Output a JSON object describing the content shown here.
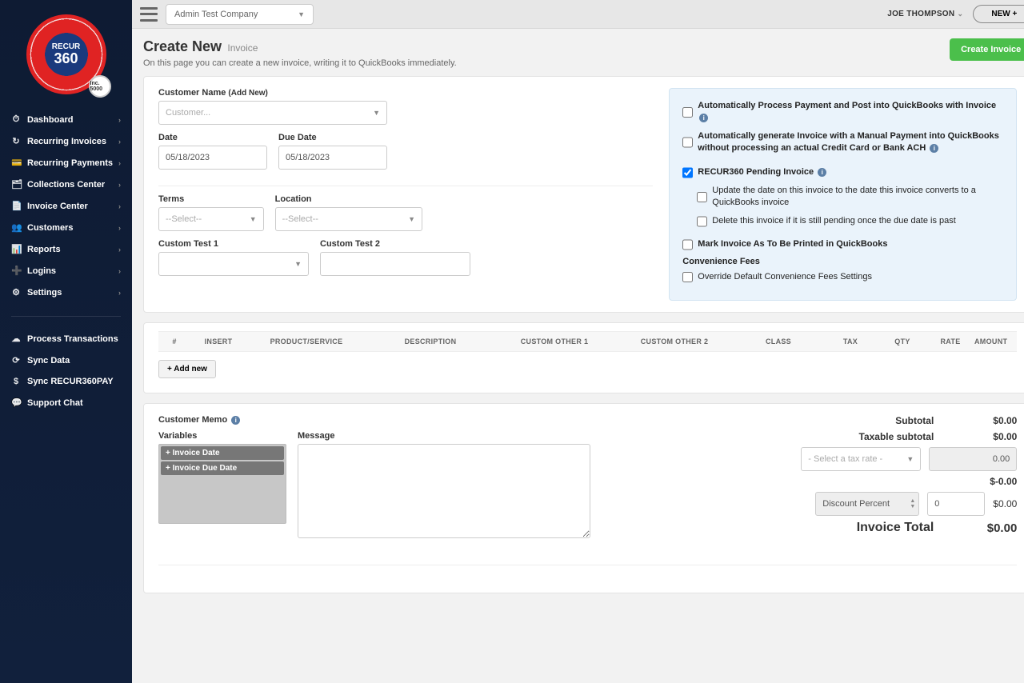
{
  "logo": {
    "top": "RECUR",
    "big": "360",
    "badge": "Inc.\n5000"
  },
  "sidebar": {
    "items": [
      {
        "icon": "⏱",
        "label": "Dashboard"
      },
      {
        "icon": "↻",
        "label": "Recurring Invoices"
      },
      {
        "icon": "💳",
        "label": "Recurring Payments"
      },
      {
        "icon": "🗂",
        "label": "Collections Center"
      },
      {
        "icon": "📄",
        "label": "Invoice Center"
      },
      {
        "icon": "👥",
        "label": "Customers"
      },
      {
        "icon": "📊",
        "label": "Reports"
      },
      {
        "icon": "➕",
        "label": "Logins"
      },
      {
        "icon": "⚙",
        "label": "Settings"
      }
    ],
    "secondary": [
      {
        "icon": "☁",
        "label": "Process Transactions"
      },
      {
        "icon": "⟳",
        "label": "Sync Data"
      },
      {
        "icon": "$",
        "label": "Sync RECUR360PAY"
      },
      {
        "icon": "💬",
        "label": "Support Chat"
      }
    ]
  },
  "topbar": {
    "company": "Admin Test Company",
    "user": "JOE THOMPSON",
    "new_btn": "NEW +"
  },
  "page": {
    "title": "Create New",
    "subtitle": "Invoice",
    "desc": "On this page you can create a new invoice, writing it to QuickBooks immediately.",
    "create_btn": "Create Invoice"
  },
  "form": {
    "customer_label": "Customer Name",
    "customer_addnew": "(Add New)",
    "customer_placeholder": "Customer...",
    "date_label": "Date",
    "date_value": "05/18/2023",
    "due_label": "Due Date",
    "due_value": "05/18/2023",
    "terms_label": "Terms",
    "terms_value": "--Select--",
    "location_label": "Location",
    "location_value": "--Select--",
    "ct1_label": "Custom Test 1",
    "ct2_label": "Custom Test 2"
  },
  "options": {
    "o1": "Automatically Process Payment and Post into QuickBooks with Invoice",
    "o2": "Automatically generate Invoice with a Manual Payment into QuickBooks without processing an actual Credit Card or Bank ACH",
    "o3": "RECUR360 Pending Invoice",
    "o3a": "Update the date on this invoice to the date this invoice converts to a QuickBooks invoice",
    "o3b": "Delete this invoice if it is still pending once the due date is past",
    "o4": "Mark Invoice As To Be Printed in QuickBooks",
    "fees_head": "Convenience Fees",
    "o5": "Override Default Convenience Fees Settings"
  },
  "table": {
    "headers": [
      "#",
      "INSERT",
      "PRODUCT/SERVICE",
      "DESCRIPTION",
      "CUSTOM OTHER 1",
      "CUSTOM OTHER 2",
      "CLASS",
      "TAX",
      "QTY",
      "RATE",
      "AMOUNT"
    ],
    "addnew": "+ Add new"
  },
  "memo": {
    "head": "Customer Memo",
    "vars_label": "Variables",
    "msg_label": "Message",
    "var1": "+ Invoice Date",
    "var2": "+ Invoice Due Date"
  },
  "totals": {
    "subtotal_label": "Subtotal",
    "subtotal": "$0.00",
    "taxable_label": "Taxable subtotal",
    "taxable": "$0.00",
    "taxrate_placeholder": "- Select a tax rate -",
    "taxamt": "0.00",
    "taxline": "$-0.00",
    "discount_type": "Discount Percent",
    "discount_val": "0",
    "total_label": "Invoice Total",
    "total": "$0.00"
  }
}
